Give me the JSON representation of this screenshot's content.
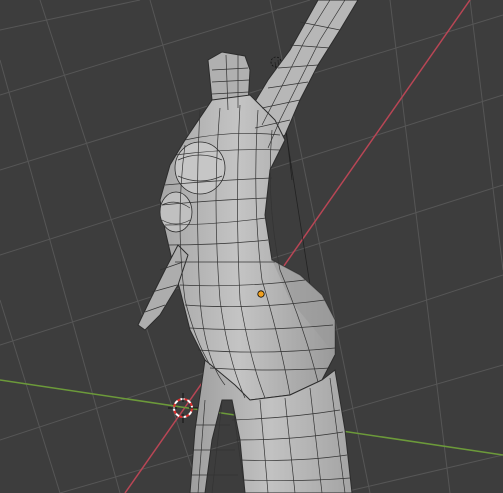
{
  "viewport": {
    "mode": "3d-viewport",
    "shading": "solid",
    "overlay": "wireframe"
  },
  "colors": {
    "background": "#3d3d3d",
    "grid_line": "#555555",
    "x_axis": "#b84655",
    "y_axis": "#6c9a3a",
    "mesh_fill": "#b8b8b8",
    "mesh_shade": "#9a9a9a",
    "mesh_highlight": "#cfcfcf",
    "wire": "#2c2c2c",
    "origin": "#f0a020",
    "cursor_red": "#e03030",
    "cursor_white": "#ffffff"
  },
  "icons": {
    "cursor": "3d-cursor-icon",
    "origin": "object-origin-icon",
    "light": "light-object-icon"
  }
}
